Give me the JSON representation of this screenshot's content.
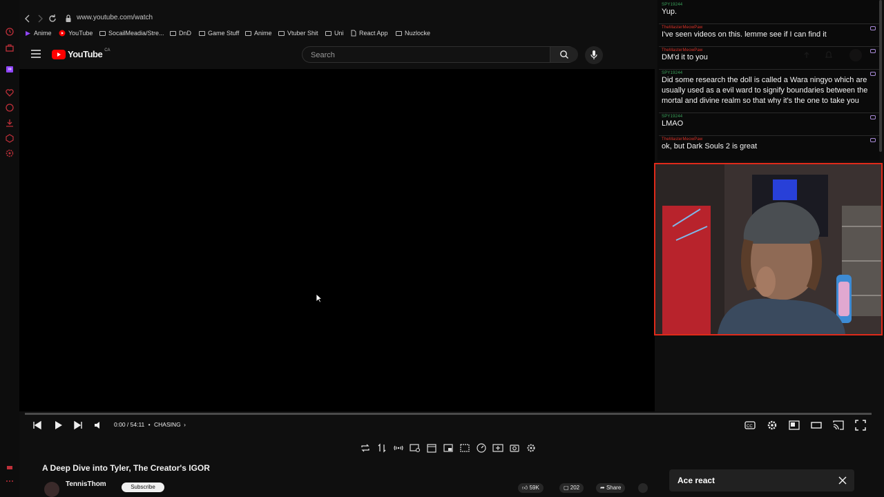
{
  "colors": {
    "background": "#0f0f0f",
    "brand_red": "#ff0000",
    "webcam_border": "#e02a1a",
    "chat_user": "#3ba55c",
    "chat_user_alt": "#e0342a"
  },
  "browser": {
    "url": "www.youtube.com/watch",
    "bookmarks": [
      {
        "label": "Anime",
        "icon": "twitch-icon"
      },
      {
        "label": "YouTube",
        "icon": "youtube-icon"
      },
      {
        "label": "SocailMeadia/Stre...",
        "icon": "folder-icon"
      },
      {
        "label": "DnD",
        "icon": "folder-icon"
      },
      {
        "label": "Game Stuff",
        "icon": "folder-icon"
      },
      {
        "label": "Anime",
        "icon": "folder-icon"
      },
      {
        "label": "Vtuber Shit",
        "icon": "folder-icon"
      },
      {
        "label": "Uni",
        "icon": "folder-icon"
      },
      {
        "label": "React App",
        "icon": "page-icon"
      },
      {
        "label": "Nuzlocke",
        "icon": "folder-icon"
      }
    ]
  },
  "youtube": {
    "logo_text": "YouTube",
    "region": "CA",
    "search_placeholder": "Search"
  },
  "chat": {
    "messages": [
      {
        "user": "SPY19244",
        "text": "Yup."
      },
      {
        "user": "TheMasterMeowPaw",
        "text": "I've seen videos on this. lemme see if I can find it"
      },
      {
        "user": "TheMasterMeowPaw",
        "text": "DM'd it to you"
      },
      {
        "user": "SPY19244",
        "text": "Did some research the doll is called a Wara ningyo which are usually used as a evil ward to signify boundaries between the mortal and divine realm so that why it's the one to take you"
      },
      {
        "user": "SPY19244",
        "text": "LMAO"
      },
      {
        "user": "TheMasterMeowPaw",
        "text": "ok, but Dark Souls 2 is great"
      }
    ]
  },
  "player": {
    "time": "0:00 / 54:11",
    "chapter": "CHASING",
    "progress_fraction": 0.0
  },
  "video": {
    "title": "A Deep Dive into Tyler, The Creator's IGOR",
    "channel": "TennisThom",
    "subscribe_label": "Subscribe",
    "likes": "59K",
    "comments": "202",
    "share_label": "Share"
  },
  "toast": {
    "text": "Ace react"
  }
}
